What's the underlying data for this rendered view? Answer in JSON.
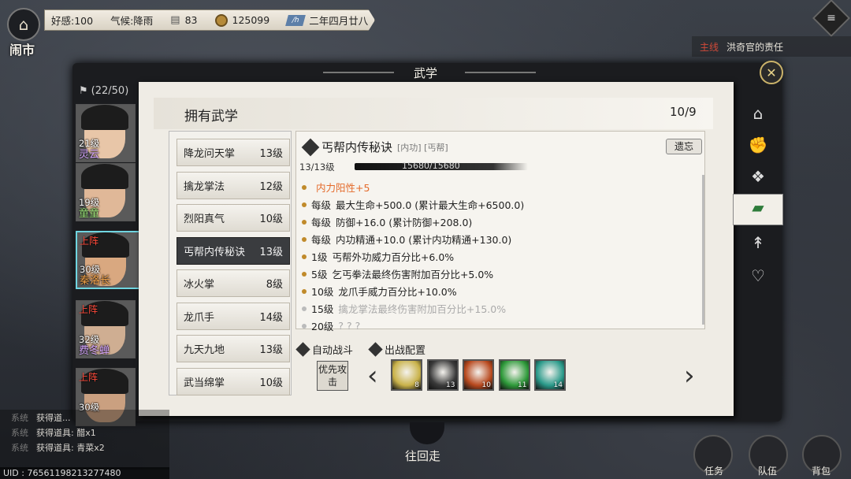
{
  "top": {
    "favor_label": "好感:100",
    "weather_label": "气候:降雨",
    "supply_value": "83",
    "coin_value": "125099",
    "date_text": "二年四月廿八",
    "location": "闹市",
    "home_icon": "home-icon",
    "menu_icon": "menu-icon"
  },
  "quest": {
    "tag": "主线",
    "name": "洪奇官的责任"
  },
  "window": {
    "title": "武学",
    "close_icon": "close-icon"
  },
  "characters": {
    "header": "(22/50)",
    "items": [
      {
        "level": "21级",
        "name": "灵云",
        "name_color": "#d7a8ff",
        "deployed": ""
      },
      {
        "level": "19级",
        "name": "童童",
        "name_color": "#9be37a",
        "deployed": ""
      },
      {
        "level": "30级",
        "name": "秦洛长",
        "name_color": "#f0a24a",
        "deployed": "上阵"
      },
      {
        "level": "32级",
        "name": "费冬蝉",
        "name_color": "#d7a8ff",
        "deployed": "上阵"
      },
      {
        "level": "30级",
        "name": "",
        "name_color": "#ffffff",
        "deployed": "上阵"
      }
    ]
  },
  "panel": {
    "title": "拥有武学",
    "count": "10/9"
  },
  "skills": [
    {
      "name": "降龙问天掌",
      "level": "13级"
    },
    {
      "name": "擒龙掌法",
      "level": "12级"
    },
    {
      "name": "烈阳真气",
      "level": "10级"
    },
    {
      "name": "丐帮内传秘诀",
      "level": "13级"
    },
    {
      "name": "冰火掌",
      "level": "8级"
    },
    {
      "name": "龙爪手",
      "level": "14级"
    },
    {
      "name": "九天九地",
      "level": "13级"
    },
    {
      "name": "武当绵掌",
      "level": "10级"
    }
  ],
  "detail": {
    "name": "丐帮内传秘诀",
    "tags": "[内功] [丐帮]",
    "forget_label": "遗忘",
    "level_progress": "13/13级",
    "exp_text": "15680/15680",
    "effects": [
      {
        "tag": "",
        "text": "内力阳性+5",
        "style": "orange"
      },
      {
        "tag": "每级",
        "text": "最大生命+500.0 (累计最大生命+6500.0)",
        "style": "normal"
      },
      {
        "tag": "每级",
        "text": "防御+16.0 (累计防御+208.0)",
        "style": "normal"
      },
      {
        "tag": "每级",
        "text": "内功精通+10.0 (累计内功精通+130.0)",
        "style": "normal"
      },
      {
        "tag": "1级",
        "text": "丐帮外功威力百分比+6.0%",
        "style": "normal"
      },
      {
        "tag": "5级",
        "text": "乞丐拳法最终伤害附加百分比+5.0%",
        "style": "normal"
      },
      {
        "tag": "10级",
        "text": "龙爪手威力百分比+10.0%",
        "style": "normal"
      },
      {
        "tag": "15级",
        "text": "擒龙掌法最终伤害附加百分比+15.0%",
        "style": "dim"
      },
      {
        "tag": "20级",
        "text": "? ? ?",
        "style": "dim"
      }
    ]
  },
  "battle": {
    "auto_label": "自动战斗",
    "config_label": "出战配置",
    "priority_label": "优先攻击",
    "left_arrow": "‹",
    "right_arrow": "›",
    "icons": [
      {
        "count": "8",
        "color": "#c9b24a"
      },
      {
        "count": "13",
        "color": "#3a3a3a"
      },
      {
        "count": "10",
        "color": "#b8491e"
      },
      {
        "count": "11",
        "color": "#2e9a3a"
      },
      {
        "count": "14",
        "color": "#2a9a8a"
      }
    ]
  },
  "tabs": [
    "lotus-icon",
    "fist-icon",
    "skill-icon",
    "book-icon",
    "hidden-weapon-icon",
    "heart-icon"
  ],
  "bottom": {
    "back_label": "往回走",
    "task_label": "任务",
    "team_label": "队伍",
    "bag_label": "背包"
  },
  "log": [
    {
      "sys": "系统",
      "msg": "获得道..."
    },
    {
      "sys": "系统",
      "msg": "获得道具: 醋x1"
    },
    {
      "sys": "系统",
      "msg": "获得道具: 青菜x2"
    }
  ],
  "uid": "UID : 76561198213277480"
}
